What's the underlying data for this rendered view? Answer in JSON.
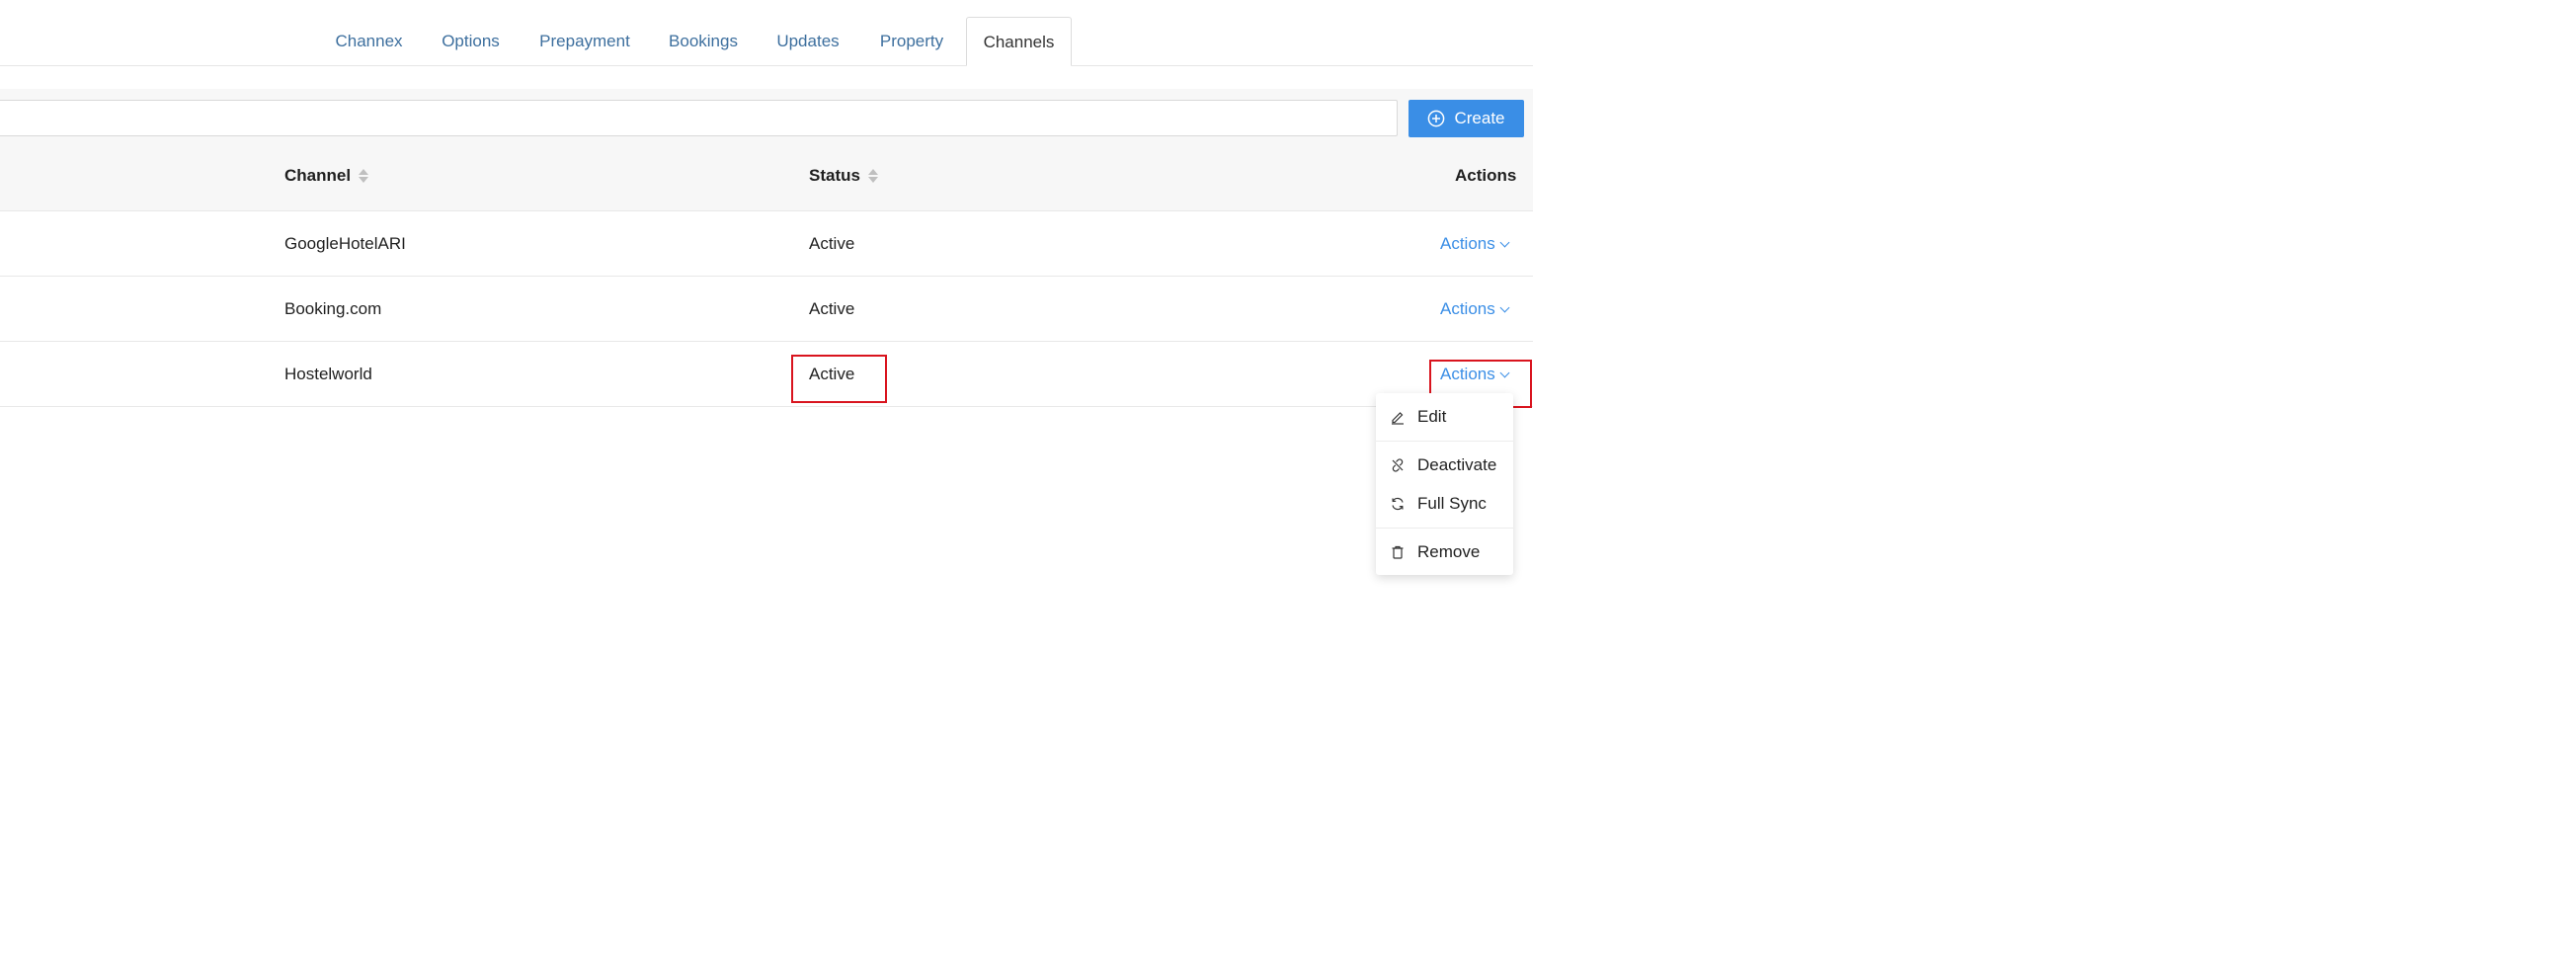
{
  "tabs": [
    {
      "label": "Channex"
    },
    {
      "label": "Options"
    },
    {
      "label": "Prepayment"
    },
    {
      "label": "Bookings"
    },
    {
      "label": "Updates"
    },
    {
      "label": "Property"
    },
    {
      "label": "Channels"
    }
  ],
  "active_tab": "Channels",
  "search": {
    "value": "",
    "placeholder": ""
  },
  "create_button": {
    "label": "Create",
    "icon": "plus-circle-icon"
  },
  "table": {
    "columns": {
      "channel": "Channel",
      "status": "Status",
      "actions": "Actions"
    },
    "rows": [
      {
        "channel": "GoogleHotelARI",
        "status": "Active",
        "actions": "Actions"
      },
      {
        "channel": "Booking.com",
        "status": "Active",
        "actions": "Actions"
      },
      {
        "channel": "Hostelworld",
        "status": "Active",
        "actions": "Actions"
      }
    ]
  },
  "dropdown": {
    "items": [
      {
        "label": "Edit",
        "icon": "edit-icon"
      },
      {
        "label": "Deactivate",
        "icon": "unlink-icon"
      },
      {
        "label": "Full Sync",
        "icon": "sync-icon"
      },
      {
        "label": "Remove",
        "icon": "trash-icon"
      }
    ]
  },
  "colors": {
    "accent": "#3a8ee6",
    "tab_link": "#3d6f9e",
    "highlight": "#d9141e"
  }
}
